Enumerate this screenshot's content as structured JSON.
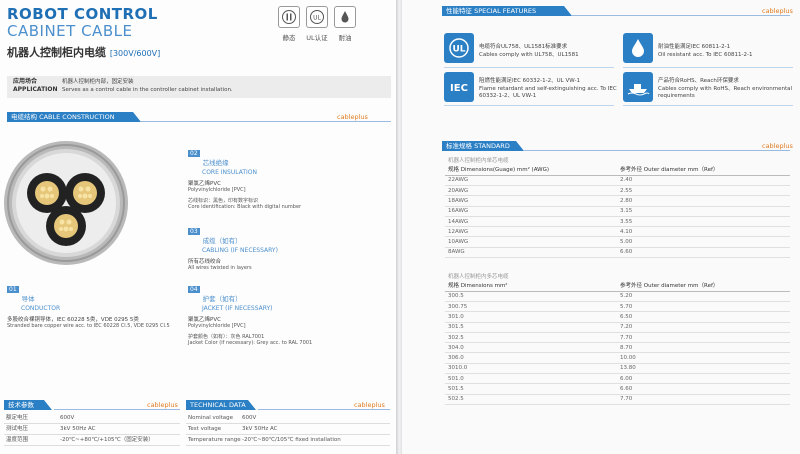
{
  "left": {
    "title_line1": "ROBOT CONTROL",
    "title_line2": "CABINET CABLE",
    "title_cn": "机器人控制柜内电缆",
    "title_rating": "[300V/600V]",
    "certs": [
      {
        "icon": "cabinet-icon",
        "label": "静态"
      },
      {
        "icon": "ul-icon",
        "label": "UL认证"
      },
      {
        "icon": "oil-drop-icon",
        "label": "耐油"
      }
    ],
    "application": {
      "key_cn": "应用场合",
      "key_en": "APPLICATION",
      "val_cn": "机器人控制柜内部，固定安装",
      "val_en": "Serves as a control cable in the controller cabinet installation."
    },
    "construction": {
      "header": "电缆结构 CABLE CONSTRUCTION",
      "brand": "cableplus",
      "parts": [
        {
          "num": "01",
          "cn": "导体",
          "en": "CONDUCTOR",
          "d1": "多股绞合裸铜导体，IEC 60228 5类，VDE 0295 5类",
          "d2": "Stranded bare copper wire acc. to IEC 60228 Cl.5, VDE 0295 Cl.5"
        },
        {
          "num": "02",
          "cn": "芯线绝缘",
          "en": "CORE INSULATION",
          "d1": "聚氯乙烯PVC",
          "d1b": "Polyvinylchloride [PVC]",
          "d2": "芯线标识：黑色，印有数字标识",
          "d2b": "Core identification: Black with digital number"
        },
        {
          "num": "03",
          "cn": "成缆（如有）",
          "en": "CABLING (IF NECESSARY)",
          "d1": "所有芯线绞合",
          "d2": "All wires twisted in layers"
        },
        {
          "num": "04",
          "cn": "护套（如有）",
          "en": "JACKET (IF NECESSARY)",
          "d1": "聚氯乙烯PVC",
          "d1b": "Polyvinylchloride [PVC]",
          "d2": "护套颜色（如有）：灰色 RAL7001",
          "d2b": "Jacket Color (if necessary): Grey acc. to RAL 7001"
        }
      ]
    },
    "tech_cn": {
      "header": "技术参数",
      "brand": "cableplus",
      "rows": [
        {
          "k": "额定电压",
          "v": "600V"
        },
        {
          "k": "测试电压",
          "v": "3kV 50Hz  AC"
        },
        {
          "k": "温度范围",
          "v": "-20℃~+80℃/+105℃（固定安装）"
        }
      ]
    },
    "tech_en": {
      "header": "TECHNICAL DATA",
      "brand": "cableplus",
      "rows": [
        {
          "k": "Nominal voltage",
          "v": "600V"
        },
        {
          "k": "Test voltage",
          "v": "3kV 50Hz  AC"
        },
        {
          "k": "Temperature range",
          "v": "-20℃~80℃/105℃ fixed installation"
        }
      ]
    }
  },
  "right": {
    "features": {
      "header": "性能特征 SPECIAL FEATURES",
      "brand": "cableplus",
      "items": [
        {
          "icon": "ul-icon",
          "color": "#2b7fc4",
          "cn": "电缆符合UL758、UL1581标准要求",
          "en": "Cables comply with UL758、UL1581"
        },
        {
          "icon": "oil-drop-icon",
          "color": "#2b7fc4",
          "cn": "耐油性能满足IEC 60811-2-1",
          "en": "Oil resistant acc. To IEC 60811-2-1"
        },
        {
          "icon": "iec-icon",
          "color": "#2b7fc4",
          "cn": "阻燃性能满足IEC 60332-1-2、UL VW-1",
          "en": "Flame retardant and self-extinguishing  acc. To IEC 60332-1-2、UL VW-1"
        },
        {
          "icon": "ship-icon",
          "color": "#2b7fc4",
          "cn": "产品符合RoHS、Reach环保要求",
          "en": "Cables comply with RoHS、Reach environmental requirements"
        }
      ]
    },
    "standard": {
      "header": "标准规格 STANDARD",
      "brand": "cableplus",
      "awg_title": "机器人控制柜内单芯电缆",
      "awg_head": {
        "a": "规格 Dimensions(Guage) mm² (AWG)",
        "b": "参考外径 Outer diameter mm（Ref）"
      },
      "awg_rows": [
        {
          "a": "22AWG",
          "b": "2.40"
        },
        {
          "a": "20AWG",
          "b": "2.55"
        },
        {
          "a": "18AWG",
          "b": "2.80"
        },
        {
          "a": "16AWG",
          "b": "3.15"
        },
        {
          "a": "14AWG",
          "b": "3.55"
        },
        {
          "a": "12AWG",
          "b": "4.10"
        },
        {
          "a": "10AWG",
          "b": "5.00"
        },
        {
          "a": "8AWG",
          "b": "6.60"
        }
      ],
      "mm_title": "机器人控制柜内多芯电缆",
      "mm_head": {
        "a": "规格 Dimensions mm²",
        "b": "参考外径 Outer diameter mm（Ref）"
      },
      "mm_rows": [
        {
          "a": "300.5",
          "b": "5.20"
        },
        {
          "a": "300.75",
          "b": "5.70"
        },
        {
          "a": "301.0",
          "b": "6.50"
        },
        {
          "a": "301.5",
          "b": "7.20"
        },
        {
          "a": "302.5",
          "b": "7.70"
        },
        {
          "a": "304.0",
          "b": "8.70"
        },
        {
          "a": "306.0",
          "b": "10.00"
        },
        {
          "a": "3010.0",
          "b": "13.80"
        },
        {
          "a": "501.0",
          "b": "6.00"
        },
        {
          "a": "501.5",
          "b": "6.60"
        },
        {
          "a": "502.5",
          "b": "7.70"
        }
      ]
    }
  }
}
